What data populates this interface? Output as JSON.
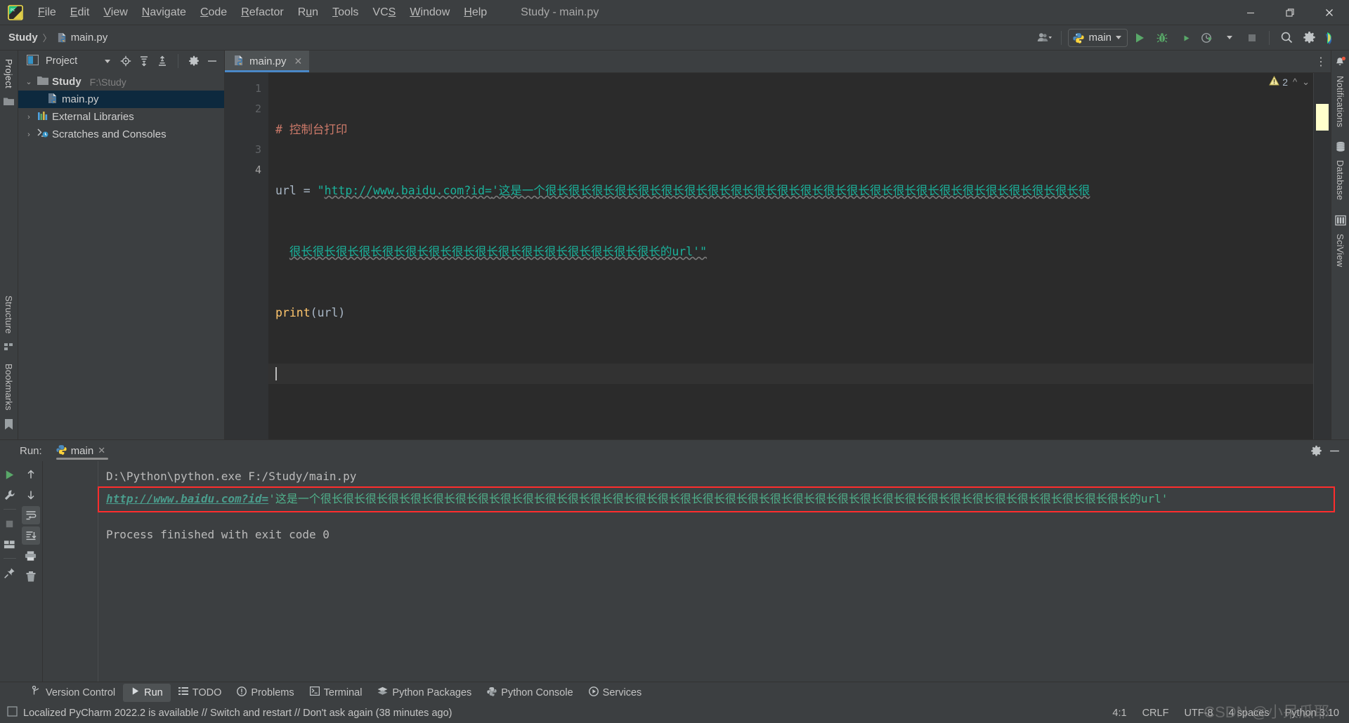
{
  "window": {
    "title": "Study - main.py",
    "controls": {
      "minimize": "—",
      "maximize": "❐",
      "close": "✕"
    }
  },
  "menubar": {
    "items": [
      {
        "label": "File"
      },
      {
        "label": "Edit"
      },
      {
        "label": "View"
      },
      {
        "label": "Navigate"
      },
      {
        "label": "Code"
      },
      {
        "label": "Refactor"
      },
      {
        "label": "Run"
      },
      {
        "label": "Tools"
      },
      {
        "label": "VCS"
      },
      {
        "label": "Window"
      },
      {
        "label": "Help"
      }
    ]
  },
  "navbar": {
    "breadcrumb": {
      "project": "Study",
      "separator": "〉",
      "file": "main.py"
    },
    "run_config": "main",
    "icons": [
      "account-icon",
      "run-icon",
      "debug-icon",
      "run-coverage-icon",
      "profile-icon",
      "stop-icon",
      "search-everywhere-icon",
      "settings-icon",
      "ide-assistant-icon"
    ]
  },
  "project_panel": {
    "header_title": "Project",
    "tree": [
      {
        "label": "Study",
        "detail": "F:\\Study",
        "icon": "folder-icon",
        "arrow": "⌄",
        "level": 0,
        "selected": false,
        "bold": true
      },
      {
        "label": "main.py",
        "detail": "",
        "icon": "python-file-icon",
        "arrow": "",
        "level": 2,
        "selected": true,
        "bold": false
      },
      {
        "label": "External Libraries",
        "detail": "",
        "icon": "library-icon",
        "arrow": "›",
        "level": 0,
        "selected": false,
        "bold": false
      },
      {
        "label": "Scratches and Consoles",
        "detail": "",
        "icon": "scratch-icon",
        "arrow": "›",
        "level": 0,
        "selected": false,
        "bold": false
      }
    ]
  },
  "left_rail": {
    "top": [
      "Project"
    ],
    "bottom": [
      "Structure",
      "Bookmarks"
    ]
  },
  "right_rail": {
    "items": [
      "Notifications",
      "Database",
      "SciView"
    ]
  },
  "editor": {
    "tab": {
      "label": "main.py",
      "close": "✕"
    },
    "warnings_count": "2",
    "warning_icon": "warning-triangle-icon",
    "gutter_lines": [
      "1",
      "2",
      "3",
      "4"
    ],
    "current_line": 4,
    "code": {
      "line1_comment": "# 控制台打印",
      "line2_var": "url",
      "line2_eq": "=",
      "line2_quote_open": "\"",
      "line2_url": "http://www.baidu.com?id=",
      "line2_text_part1": "'这是一个很长很长很长很长很长很长很长很长很长很长很长很长很长很长很长很长很长很长很长很长很长很长很长很",
      "line2_text_part2": "很长很长很长很长很长很长很长很长很长很长很长很长很长很长很长很长的url'\"",
      "line3_fn": "print",
      "line3_args": "(url)"
    }
  },
  "run_panel": {
    "label": "Run:",
    "tab": {
      "label": "main",
      "close": "✕",
      "icon": "python-icon"
    },
    "toolbar_left": [
      "rerun-icon",
      "wrench-icon",
      "stop-icon",
      "layout-icon",
      "pin-icon"
    ],
    "toolbar_left2": [
      "up-arrow-icon",
      "down-arrow-icon",
      "soft-wrap-icon",
      "scroll-end-icon",
      "print-icon",
      "trash-icon"
    ],
    "toolbar_right": [
      "settings-icon",
      "hide-icon"
    ],
    "console": {
      "command": "D:\\Python\\python.exe F:/Study/main.py",
      "output_url": "http://www.baidu.com?id=",
      "output_text_part1": "'这是一个很长很长很长很长很长很长很长很长很长很长很长很长很长很长很长很长很长很长很长很长很长很长很长很长很长很长很长很长很长很长很",
      "output_text_part2": "长很长很长很长很长很长的url'",
      "exit_line": "Process finished with exit code 0",
      "highlight_color": "#ff2d2d"
    }
  },
  "bottom_bar": {
    "items": [
      {
        "label": "Version Control",
        "icon": "branch-icon",
        "active": false
      },
      {
        "label": "Run",
        "icon": "play-icon",
        "active": true
      },
      {
        "label": "TODO",
        "icon": "list-icon",
        "active": false
      },
      {
        "label": "Problems",
        "icon": "exclamation-icon",
        "active": false
      },
      {
        "label": "Terminal",
        "icon": "terminal-icon",
        "active": false
      },
      {
        "label": "Python Packages",
        "icon": "packages-icon",
        "active": false
      },
      {
        "label": "Python Console",
        "icon": "python-icon",
        "active": false
      },
      {
        "label": "Services",
        "icon": "services-icon",
        "active": false
      }
    ]
  },
  "status_bar": {
    "message": "Localized PyCharm 2022.2 is available // Switch and restart // Don't ask again (38 minutes ago)",
    "caret_position": "4:1",
    "line_separator": "CRLF",
    "encoding": "UTF-8",
    "indent": "4 spaces",
    "interpreter": "Python 3.10",
    "watermark": "CSDN @小呆瓜耶"
  }
}
